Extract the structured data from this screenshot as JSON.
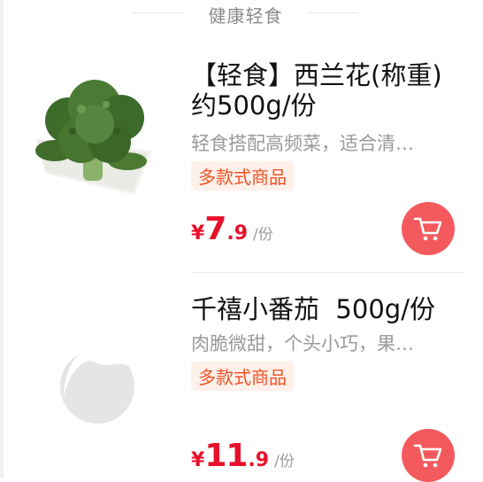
{
  "section": {
    "title": "健康轻食"
  },
  "products": [
    {
      "name": "【轻食】西兰花(称重)\n约500g/份",
      "desc": "轻食搭配高频菜，适合清…",
      "tag": "多款式商品",
      "price_symbol": "¥",
      "price_int": "7",
      "price_dec": ".9",
      "price_unit": "/份"
    },
    {
      "name": "千禧小番茄  500g/份",
      "desc": "肉脆微甜，个头小巧，果…",
      "tag": "多款式商品",
      "price_symbol": "¥",
      "price_int": "11",
      "price_dec": ".9",
      "price_unit": "/份"
    }
  ],
  "colors": {
    "accent": "#e8102a",
    "cart": "#f45a5d",
    "tag_bg": "#fff0ea",
    "tag_text": "#ef5326"
  },
  "icons": [
    "broccoli-image",
    "placeholder-image-icon",
    "cart-icon"
  ]
}
